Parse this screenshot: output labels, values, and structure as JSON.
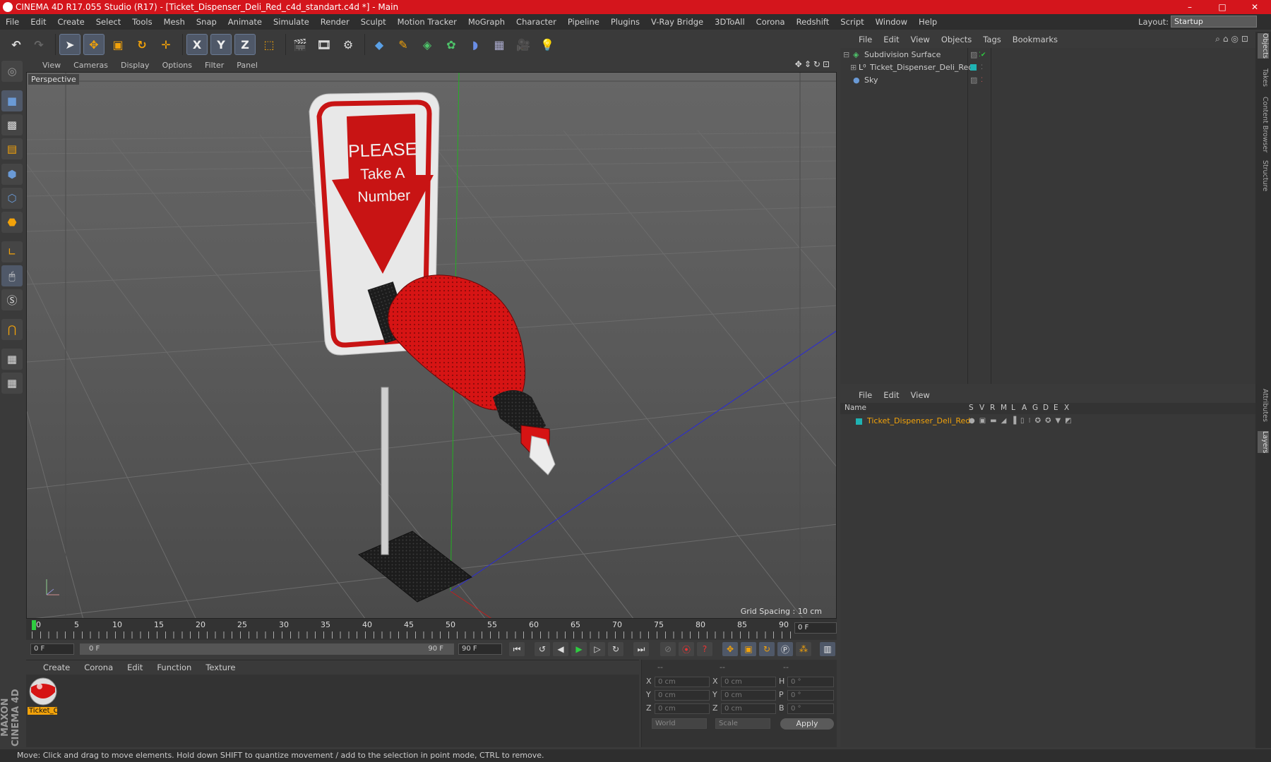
{
  "window": {
    "title": "CINEMA 4D R17.055 Studio (R17) - [Ticket_Dispenser_Deli_Red_c4d_standart.c4d *] - Main",
    "controls": [
      "–",
      "□",
      "✕"
    ]
  },
  "menu": [
    "File",
    "Edit",
    "Create",
    "Select",
    "Tools",
    "Mesh",
    "Snap",
    "Animate",
    "Simulate",
    "Render",
    "Sculpt",
    "Motion Tracker",
    "MoGraph",
    "Character",
    "Pipeline",
    "Plugins",
    "V-Ray Bridge",
    "3DToAll",
    "Corona",
    "Redshift",
    "Script",
    "Window",
    "Help"
  ],
  "layout": {
    "label": "Layout:",
    "value": "Startup"
  },
  "toolbar": {
    "x_label": "X",
    "y_label": "Y",
    "z_label": "Z"
  },
  "viewport": {
    "menu": [
      "View",
      "Cameras",
      "Display",
      "Options",
      "Filter",
      "Panel"
    ],
    "name": "Perspective",
    "grid_spacing": "Grid Spacing : 10 cm",
    "sign_text": [
      "PLEASE",
      "Take A",
      "Number"
    ]
  },
  "timeline": {
    "ticks": [
      "0",
      "5",
      "10",
      "15",
      "20",
      "25",
      "30",
      "35",
      "40",
      "45",
      "50",
      "55",
      "60",
      "65",
      "70",
      "75",
      "80",
      "85",
      "90"
    ],
    "current_frame": "0 F"
  },
  "transport": {
    "start": "0 F",
    "range_start": "0 F",
    "range_end": "90 F",
    "end": "90 F"
  },
  "material_manager": {
    "menu": [
      "Create",
      "Corona",
      "Edit",
      "Function",
      "Texture"
    ],
    "material_name": "Ticket_C"
  },
  "coordinates": {
    "headers": [
      "--",
      "--",
      "--"
    ],
    "rows": [
      {
        "a": "X",
        "pos": "0 cm",
        "b": "X",
        "size": "0 cm",
        "c": "H",
        "rot": "0 °"
      },
      {
        "a": "Y",
        "pos": "0 cm",
        "b": "Y",
        "size": "0 cm",
        "c": "P",
        "rot": "0 °"
      },
      {
        "a": "Z",
        "pos": "0 cm",
        "b": "Z",
        "size": "0 cm",
        "c": "B",
        "rot": "0 °"
      }
    ],
    "mode": "World",
    "size_mode": "Scale",
    "apply": "Apply"
  },
  "object_manager": {
    "menu": [
      "File",
      "Edit",
      "View",
      "Objects",
      "Tags",
      "Bookmarks"
    ],
    "objects": [
      "Subdivision Surface",
      "Ticket_Dispenser_Deli_Red",
      "Sky"
    ]
  },
  "layer_manager": {
    "menu": [
      "File",
      "Edit",
      "View"
    ],
    "columns": [
      "Name",
      "S",
      "V",
      "R",
      "M",
      "L",
      "A",
      "G",
      "D",
      "E",
      "X"
    ],
    "layers": [
      "Ticket_Dispenser_Deli_Red"
    ]
  },
  "side_tabs": [
    "Objects",
    "Takes",
    "Content Browser",
    "Structure",
    "Attributes",
    "Layers"
  ],
  "brand": "MAXON CINEMA 4D",
  "status": "Move: Click and drag to move elements. Hold down SHIFT to quantize movement / add to the selection in point mode, CTRL to remove.",
  "colors": {
    "titlebar": "#d4151c",
    "accent_orange": "#f2a20a",
    "layer_teal": "#1fb3b3"
  }
}
